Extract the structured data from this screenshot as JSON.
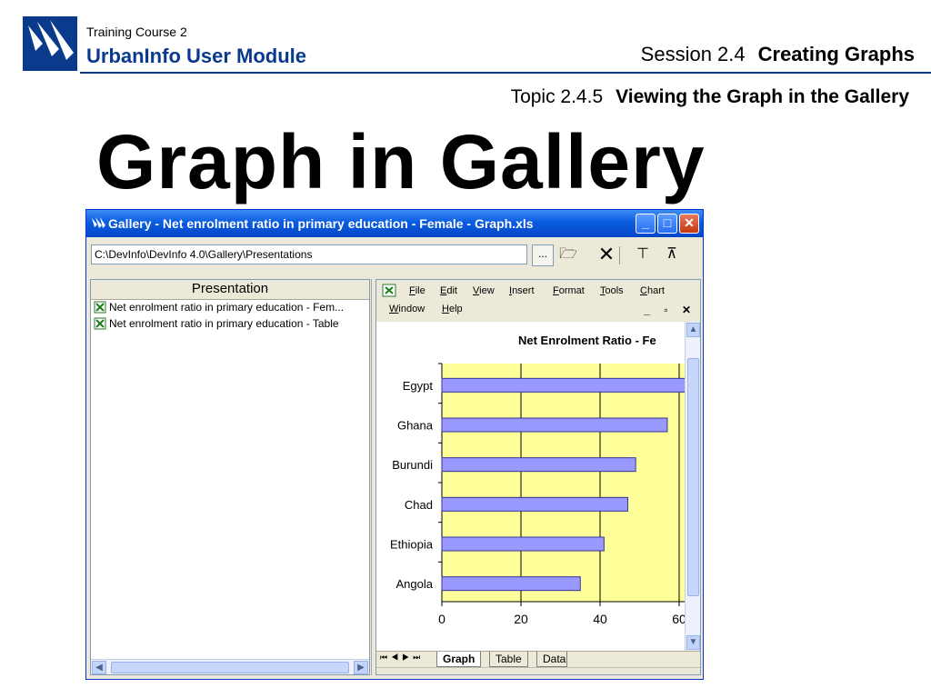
{
  "slide": {
    "course": "Training Course 2",
    "module": "UrbanInfo User Module",
    "session_label": "Session 2.4",
    "session_title": "Creating Graphs",
    "topic_label": "Topic 2.4.5",
    "topic_title": "Viewing the Graph in the Gallery",
    "heading": "Graph in Gallery"
  },
  "window": {
    "title": "Gallery - Net enrolment ratio in primary education - Female - Graph.xls",
    "path": "C:\\DevInfo\\DevInfo 4.0\\Gallery\\Presentations",
    "browse_label": "...",
    "left_pane": {
      "header": "Presentation",
      "items": [
        "Net enrolment ratio in primary education - Fem...",
        "Net enrolment ratio in primary education - Table"
      ]
    },
    "menu": [
      "File",
      "Edit",
      "View",
      "Insert",
      "Format",
      "Tools",
      "Chart",
      "Window",
      "Help"
    ],
    "sheet_tabs": [
      "Graph",
      "Table",
      "Data"
    ]
  },
  "colors": {
    "brand": "#0a3a8c",
    "plot_bg": "#ffff99",
    "bar_fill": "#9999ff",
    "bar_stroke": "#333399"
  },
  "chart_data": {
    "type": "bar",
    "orientation": "horizontal",
    "title": "Net Enrolment Ratio - Fe",
    "categories": [
      "Egypt",
      "Ghana",
      "Burundi",
      "Chad",
      "Ethiopia",
      "Angola"
    ],
    "values": [
      62,
      57,
      49,
      47,
      41,
      35
    ],
    "xticks": [
      "0",
      "20",
      "40",
      "60"
    ],
    "xlim": [
      0,
      60
    ],
    "grid": true
  }
}
